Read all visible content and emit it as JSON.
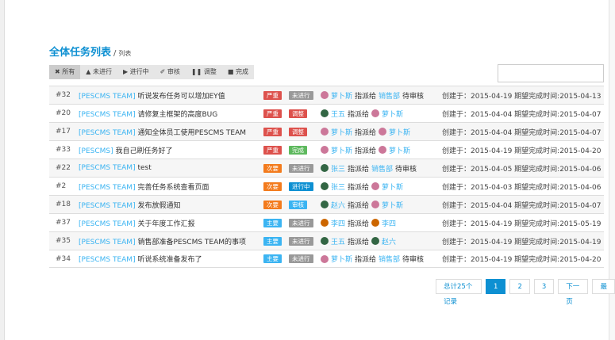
{
  "header": {
    "title": "全体任务列表",
    "separator": "/",
    "subtitle": "列表"
  },
  "filters": [
    {
      "icon": "✖",
      "label": "所有"
    },
    {
      "icon": "▲",
      "label": "未进行"
    },
    {
      "icon": "▶",
      "label": "进行中"
    },
    {
      "icon": "✐",
      "label": "审核"
    },
    {
      "icon": "❚❚",
      "label": "调整"
    },
    {
      "icon": "■",
      "label": "完成"
    }
  ],
  "search": {
    "value": "",
    "placeholder": ""
  },
  "colors": {
    "严重": "#dd514c",
    "次要": "#f37b1d",
    "主要": "#3bb4f2",
    "未进行": "#999999",
    "调整": "#dd514c",
    "完成": "#5eb95e",
    "进行中": "#0e90d2",
    "审核": "#3bb4f2"
  },
  "tasks": [
    {
      "id": "#32",
      "team": "[PESCMS TEAM]",
      "title": "听说发布任务可以增加EY值",
      "priority": "严重",
      "status": "未进行",
      "from": "萝卜斯",
      "from_av": "#c79",
      "action": "指派给",
      "to": "销售部",
      "to_av": "",
      "suffix": "待审核",
      "created": "创建于：2015-04-19 期望完成时间:2015-04-13"
    },
    {
      "id": "#20",
      "team": "[PESCMS TEAM]",
      "title": "请修复主框架的高度BUG",
      "priority": "严重",
      "status": "调整",
      "from": "王五",
      "from_av": "#364",
      "action": "指派给",
      "to": "萝卜斯",
      "to_av": "#c79",
      "suffix": "",
      "created": "创建于：2015-04-04 期望完成时间:2015-04-07"
    },
    {
      "id": "#17",
      "team": "[PESCMS TEAM]",
      "title": "通知全体员工使用PESCMS TEAM",
      "priority": "严重",
      "status": "调整",
      "from": "萝卜斯",
      "from_av": "#c79",
      "action": "指派给",
      "to": "萝卜斯",
      "to_av": "#c79",
      "suffix": "",
      "created": "创建于：2015-04-04 期望完成时间:2015-04-07"
    },
    {
      "id": "#33",
      "team": "[PESCMS]",
      "title": "我自己刷任务好了",
      "priority": "严重",
      "status": "完成",
      "from": "萝卜斯",
      "from_av": "#c79",
      "action": "指派给",
      "to": "萝卜斯",
      "to_av": "#c79",
      "suffix": "",
      "created": "创建于：2015-04-19 期望完成时间:2015-04-20"
    },
    {
      "id": "#22",
      "team": "[PESCMS TEAM]",
      "title": "test",
      "priority": "次要",
      "status": "未进行",
      "from": "张三",
      "from_av": "#364",
      "action": "指派给",
      "to": "销售部",
      "to_av": "",
      "suffix": "待审核",
      "created": "创建于：2015-04-05 期望完成时间:2015-04-06"
    },
    {
      "id": "#2",
      "team": "[PESCMS TEAM]",
      "title": "完善任务系统查看页面",
      "priority": "次要",
      "status": "进行中",
      "from": "张三",
      "from_av": "#364",
      "action": "指派给",
      "to": "萝卜斯",
      "to_av": "#c79",
      "suffix": "",
      "created": "创建于：2015-04-03 期望完成时间:2015-04-06"
    },
    {
      "id": "#18",
      "team": "[PESCMS TEAM]",
      "title": "发布放假通知",
      "priority": "次要",
      "status": "审核",
      "from": "赵六",
      "from_av": "#364",
      "action": "指派给",
      "to": "萝卜斯",
      "to_av": "#c79",
      "suffix": "",
      "created": "创建于：2015-04-04 期望完成时间:2015-04-07"
    },
    {
      "id": "#37",
      "team": "[PESCMS TEAM]",
      "title": "关于年度工作汇报",
      "priority": "主要",
      "status": "未进行",
      "from": "李四",
      "from_av": "#c60",
      "action": "指派给",
      "to": "李四",
      "to_av": "#c60",
      "suffix": "",
      "created": "创建于：2015-04-19 期望完成时间:2015-05-19"
    },
    {
      "id": "#35",
      "team": "[PESCMS TEAM]",
      "title": "销售部准备PESCMS TEAM的事项",
      "priority": "主要",
      "status": "未进行",
      "from": "王五",
      "from_av": "#364",
      "action": "指派给",
      "to": "赵六",
      "to_av": "#364",
      "suffix": "",
      "created": "创建于：2015-04-19 期望完成时间:2015-04-19"
    },
    {
      "id": "#34",
      "team": "[PESCMS TEAM]",
      "title": "听说系统准备发布了",
      "priority": "主要",
      "status": "未进行",
      "from": "萝卜斯",
      "from_av": "#c79",
      "action": "指派给",
      "to": "销售部",
      "to_av": "",
      "suffix": "待审核",
      "created": "创建于：2015-04-19 期望完成时间:2015-04-20"
    }
  ],
  "pagination": {
    "total": "总计25个记录",
    "pages": [
      "1",
      "2",
      "3"
    ],
    "next": "下一页",
    "last": "最"
  }
}
